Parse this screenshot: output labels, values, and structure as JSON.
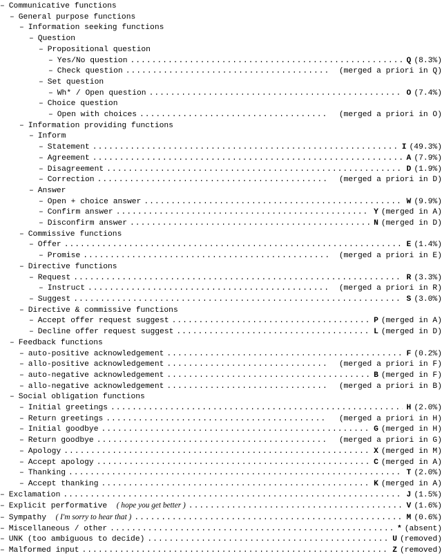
{
  "tree": [
    {
      "depth": 0,
      "label": "Communicative functions"
    },
    {
      "depth": 1,
      "label": "General purpose functions"
    },
    {
      "depth": 2,
      "label": "Information seeking functions"
    },
    {
      "depth": 3,
      "label": "Question"
    },
    {
      "depth": 4,
      "label": "Propositional question"
    },
    {
      "depth": 5,
      "label": "Yes/No question",
      "tag": "Q",
      "ann": "(8.3%)"
    },
    {
      "depth": 5,
      "label": "Check question",
      "tag": "",
      "ann": "(merged a priori in Q)"
    },
    {
      "depth": 4,
      "label": "Set question"
    },
    {
      "depth": 5,
      "label": "Wh* / Open question",
      "tag": "O",
      "ann": "(7.4%)"
    },
    {
      "depth": 4,
      "label": "Choice question"
    },
    {
      "depth": 5,
      "label": "Open with choices",
      "tag": "",
      "ann": "(merged a priori in O)"
    },
    {
      "depth": 2,
      "label": "Information providing functions"
    },
    {
      "depth": 3,
      "label": "Inform"
    },
    {
      "depth": 4,
      "label": "Statement",
      "tag": "I",
      "ann": "(49.3%)"
    },
    {
      "depth": 4,
      "label": "Agreement",
      "tag": "A",
      "ann": "(7.9%)"
    },
    {
      "depth": 4,
      "label": "Disagreement",
      "tag": "D",
      "ann": "(1.9%)"
    },
    {
      "depth": 4,
      "label": "Correction",
      "tag": "",
      "ann": "(merged a priori in D)"
    },
    {
      "depth": 3,
      "label": "Answer"
    },
    {
      "depth": 4,
      "label": "Open + choice answer",
      "tag": "W",
      "ann": "(9.9%)"
    },
    {
      "depth": 4,
      "label": "Confirm answer",
      "tag": "Y",
      "ann": "(merged in A)"
    },
    {
      "depth": 4,
      "label": "Disconfirm answer",
      "tag": "N",
      "ann": "(merged in D)"
    },
    {
      "depth": 2,
      "label": "Commissive functions"
    },
    {
      "depth": 3,
      "label": "Offer",
      "tag": "E",
      "ann": "(1.4%)"
    },
    {
      "depth": 4,
      "label": "Promise",
      "tag": "",
      "ann": "(merged a priori in E)"
    },
    {
      "depth": 2,
      "label": "Directive functions"
    },
    {
      "depth": 3,
      "label": "Request",
      "tag": "R",
      "ann": "(3.3%)"
    },
    {
      "depth": 4,
      "label": "Instruct",
      "tag": "",
      "ann": "(merged a priori in R)"
    },
    {
      "depth": 3,
      "label": "Suggest",
      "tag": "S",
      "ann": "(3.0%)"
    },
    {
      "depth": 2,
      "label": "Directive & commissive functions"
    },
    {
      "depth": 3,
      "label": "Accept offer request suggest",
      "tag": "P",
      "ann": "(merged in A)"
    },
    {
      "depth": 3,
      "label": "Decline offer request suggest",
      "tag": "L",
      "ann": "(merged in D)"
    },
    {
      "depth": 1,
      "label": "Feedback functions"
    },
    {
      "depth": 2,
      "label": "auto-positive acknowledgement",
      "tag": "F",
      "ann": "(0.2%)"
    },
    {
      "depth": 2,
      "label": "allo-positive acknowledgement",
      "tag": "",
      "ann": "(merged a priori in F)"
    },
    {
      "depth": 2,
      "label": "auto-negative acknowledgement",
      "tag": "B",
      "ann": "(merged in F)"
    },
    {
      "depth": 2,
      "label": "allo-negative acknowledgement",
      "tag": "",
      "ann": "(merged a priori in B)"
    },
    {
      "depth": 1,
      "label": "Social obligation functions"
    },
    {
      "depth": 2,
      "label": "Initial greetings",
      "tag": "H",
      "ann": "(2.0%)"
    },
    {
      "depth": 2,
      "label": "Return greetings",
      "tag": "",
      "ann": "(merged a priori in H)"
    },
    {
      "depth": 2,
      "label": "Initial goodbye",
      "tag": "G",
      "ann": "(merged in H)"
    },
    {
      "depth": 2,
      "label": "Return goodbye",
      "tag": "",
      "ann": "(merged a priori in G)"
    },
    {
      "depth": 2,
      "label": "Apology",
      "tag": "X",
      "ann": "(merged in M)"
    },
    {
      "depth": 2,
      "label": "Accept apology",
      "tag": "C",
      "ann": "(merged in A)"
    },
    {
      "depth": 2,
      "label": "Thanking",
      "tag": "T",
      "ann": "(2.0%)"
    },
    {
      "depth": 2,
      "label": "Accept thanking",
      "tag": "K",
      "ann": "(merged in A)"
    },
    {
      "depth": 0,
      "label": "Exclamation",
      "tag": "J",
      "ann": "(1.5%)"
    },
    {
      "depth": 0,
      "label": "Explicit performative",
      "example": "( hope you get better )",
      "tag": "V",
      "ann": "(1.6%)"
    },
    {
      "depth": 0,
      "label": "Sympathy",
      "example": "( I'm sorry to hear that )",
      "tag": "M",
      "ann": "(0.6%)"
    },
    {
      "depth": 0,
      "label": "Miscellaneous / other",
      "tag": "*",
      "ann": "(absent)"
    },
    {
      "depth": 0,
      "label": "UNK (too ambiguous to decide)",
      "tag": "U",
      "ann": "(removed)"
    },
    {
      "depth": 0,
      "label": "Malformed input",
      "tag": "Z",
      "ann": "(removed)"
    }
  ],
  "bullet": "–"
}
